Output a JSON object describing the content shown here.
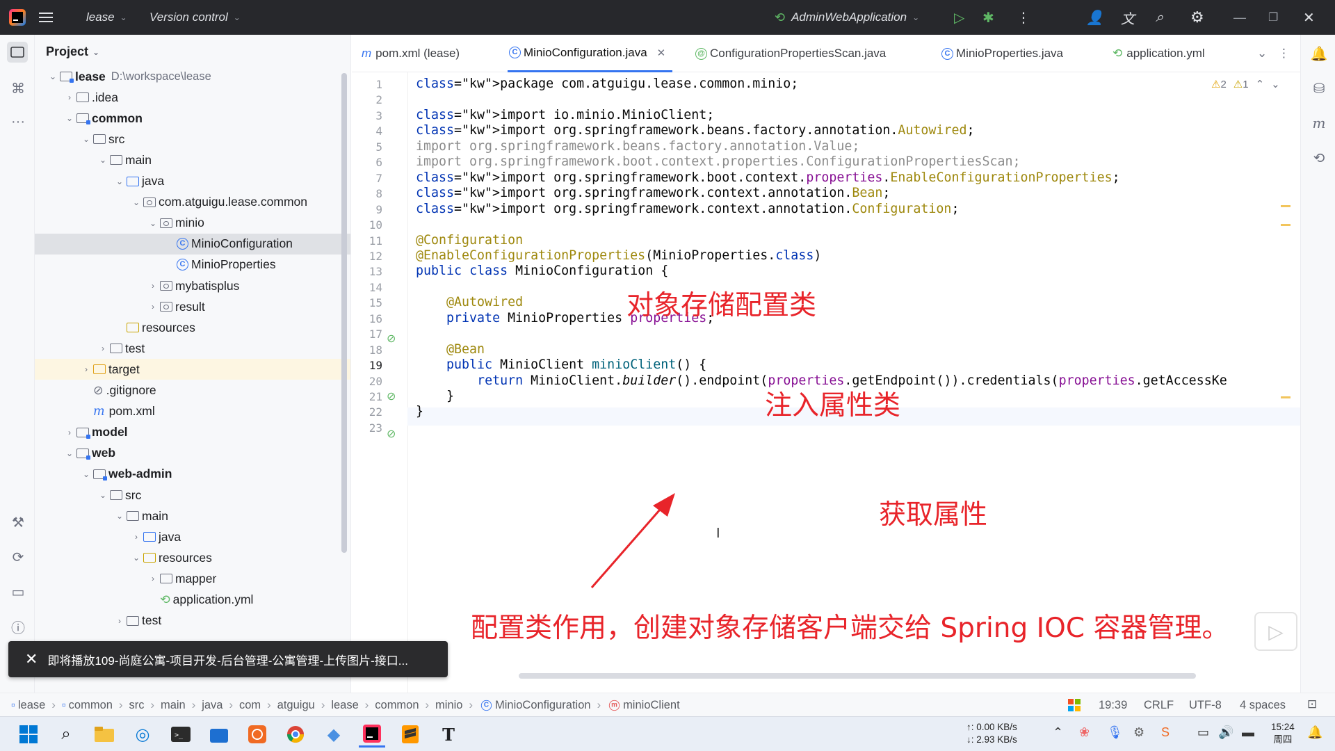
{
  "titlebar": {
    "project_name": "lease",
    "vcs_label": "Version control",
    "run_config": "AdminWebApplication"
  },
  "project_panel": {
    "title": "Project",
    "tree": [
      {
        "label": "lease",
        "suffix": "D:\\workspace\\lease",
        "icon": "module-folder-icon",
        "expanded": true
      },
      {
        "label": ".idea",
        "icon": "folder-icon",
        "expanded": false
      },
      {
        "label": "common",
        "icon": "module-folder-icon",
        "expanded": true
      },
      {
        "label": "src",
        "icon": "folder-icon",
        "expanded": true
      },
      {
        "label": "main",
        "icon": "folder-icon",
        "expanded": true
      },
      {
        "label": "java",
        "icon": "source-folder-icon",
        "expanded": true
      },
      {
        "label": "com.atguigu.lease.common",
        "icon": "package-icon",
        "expanded": true
      },
      {
        "label": "minio",
        "icon": "package-icon",
        "expanded": true
      },
      {
        "label": "MinioConfiguration",
        "icon": "class-icon",
        "selected": true
      },
      {
        "label": "MinioProperties",
        "icon": "class-icon"
      },
      {
        "label": "mybatisplus",
        "icon": "package-icon",
        "expanded": false
      },
      {
        "label": "result",
        "icon": "package-icon",
        "expanded": false
      },
      {
        "label": "resources",
        "icon": "resources-folder-icon"
      },
      {
        "label": "test",
        "icon": "folder-icon",
        "expanded": false
      },
      {
        "label": "target",
        "icon": "excluded-folder-icon",
        "expanded": false,
        "highlighted": true
      },
      {
        "label": ".gitignore",
        "icon": "ignore-file-icon"
      },
      {
        "label": "pom.xml",
        "icon": "maven-icon"
      },
      {
        "label": "model",
        "icon": "module-folder-icon",
        "expanded": false
      },
      {
        "label": "web",
        "icon": "module-folder-icon",
        "expanded": true
      },
      {
        "label": "web-admin",
        "icon": "module-folder-icon",
        "expanded": true
      },
      {
        "label": "src",
        "icon": "folder-icon",
        "expanded": true
      },
      {
        "label": "main",
        "icon": "folder-icon",
        "expanded": true
      },
      {
        "label": "java",
        "icon": "source-folder-icon",
        "expanded": false
      },
      {
        "label": "resources",
        "icon": "resources-folder-icon",
        "expanded": true
      },
      {
        "label": "mapper",
        "icon": "folder-icon",
        "expanded": false
      },
      {
        "label": "application.yml",
        "icon": "spring-config-icon"
      },
      {
        "label": "test",
        "icon": "folder-icon",
        "expanded": false
      }
    ]
  },
  "tabs": [
    {
      "label": "pom.xml (lease)",
      "icon": "maven-icon"
    },
    {
      "label": "MinioConfiguration.java",
      "icon": "class-icon",
      "active": true
    },
    {
      "label": "ConfigurationPropertiesScan.java",
      "icon": "annotation-icon"
    },
    {
      "label": "MinioProperties.java",
      "icon": "class-icon"
    },
    {
      "label": "application.yml",
      "icon": "spring-config-icon"
    }
  ],
  "inspections": {
    "warnings": "2",
    "weak_warnings": "1"
  },
  "code": {
    "current_line": "19",
    "lines": [
      "package com.atguigu.lease.common.minio;",
      "",
      "import io.minio.MinioClient;",
      "import org.springframework.beans.factory.annotation.Autowired;",
      "import org.springframework.beans.factory.annotation.Value;",
      "import org.springframework.boot.context.properties.ConfigurationPropertiesScan;",
      "import org.springframework.boot.context.properties.EnableConfigurationProperties;",
      "import org.springframework.context.annotation.Bean;",
      "import org.springframework.context.annotation.Configuration;",
      "",
      "@Configuration",
      "@EnableConfigurationProperties(MinioProperties.class)",
      "public class MinioConfiguration {",
      "",
      "    @Autowired",
      "    private MinioProperties properties;",
      "",
      "    @Bean",
      "    public MinioClient minioClient() {",
      "        return MinioClient.builder().endpoint(properties.getEndpoint()).credentials(properties.getAccessKe",
      "    }",
      "}",
      ""
    ]
  },
  "annotations_overlay": {
    "note_config_class": "对象存储配置类",
    "note_inject": "注入属性类",
    "note_get_props": "获取属性",
    "note_summary": "配置类作用，创建对象存储客户端交给 Spring IOC 容器管理。"
  },
  "toast": {
    "text": "即将播放109-尚庭公寓-项目开发-后台管理-公寓管理-上传图片-接口..."
  },
  "breadcrumb": [
    "lease",
    "common",
    "src",
    "main",
    "java",
    "com",
    "atguigu",
    "lease",
    "common",
    "minio",
    "MinioConfiguration",
    "minioClient"
  ],
  "status": {
    "position": "19:39",
    "line_sep": "CRLF",
    "encoding": "UTF-8",
    "indent": "4 spaces"
  },
  "taskbar": {
    "net_up": "↑: 0.00 KB/s",
    "net_down": "↓: 2.93 KB/s",
    "time": "15:24",
    "day": "周四"
  },
  "colors": {
    "accent": "#3574f0",
    "note_red": "#e8242a",
    "keyword": "#0033b3",
    "annotation": "#9e880d",
    "field": "#871094"
  }
}
